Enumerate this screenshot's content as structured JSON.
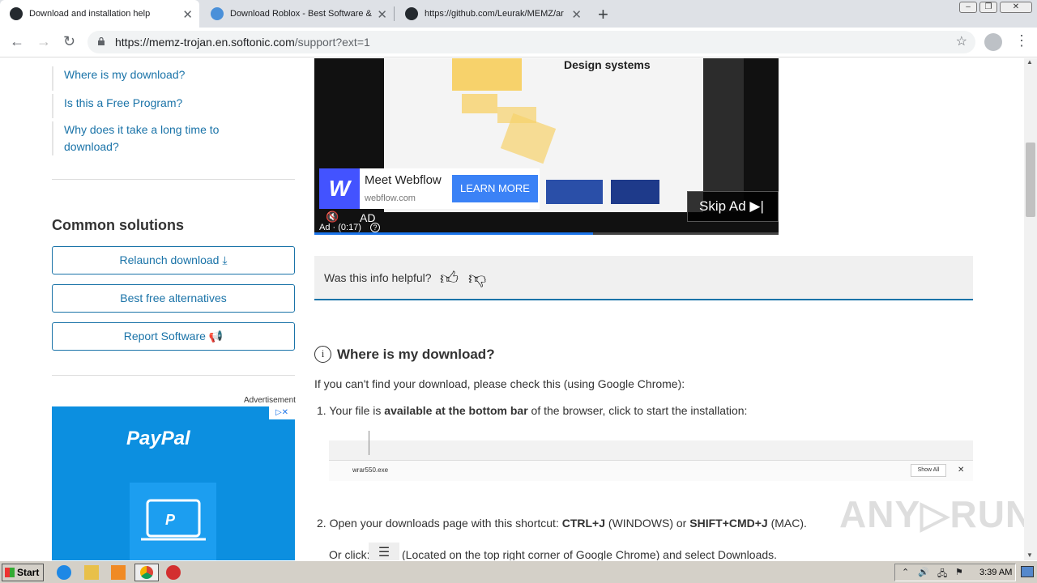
{
  "browser": {
    "tabs": [
      {
        "title": "Download and installation help",
        "active": true,
        "favicon_color": "#24292e"
      },
      {
        "title": "Download Roblox - Best Software &",
        "active": false,
        "favicon_color": "#4a90d9"
      },
      {
        "title": "https://github.com/Leurak/MEMZ/ar",
        "active": false,
        "favicon_color": "#24292e"
      }
    ],
    "new_tab": "+",
    "address": {
      "host": "https://memz-trojan.en.softonic.com",
      "path": "/support?ext=1"
    }
  },
  "sidebar": {
    "links": [
      "Where is my download?",
      "Is this a Free Program?",
      "Why does it take a long time to",
      "download?"
    ],
    "common_title": "Common solutions",
    "buttons": [
      "Relaunch download",
      "Best free alternatives",
      "Report Software"
    ],
    "advertisement_label": "Advertisement",
    "paypal_logo": "PayPal"
  },
  "video_ad": {
    "screen_title": "Design systems",
    "advertiser": "Meet Webflow",
    "advertiser_url": "webflow.com",
    "cta": "LEARN MORE",
    "skip": "Skip Ad",
    "ad_label": "AD",
    "ad_time": "Ad · (0:17)",
    "progress": 0.6
  },
  "helpful": {
    "question": "Was this info helpful?"
  },
  "article": {
    "heading": "Where is my download?",
    "intro": "If you can't find your download, please check this (using Google Chrome):",
    "step1_pre": "1. Your file is ",
    "step1_bold": "available at the bottom bar",
    "step1_post": " of the browser, click to start the installation:",
    "image_file": "wrar550.exe",
    "image_show_all": "Show All",
    "step2_pre": "2. Open your downloads page with this shortcut: ",
    "step2_k1": "CTRL+J",
    "step2_mid": " (WINDOWS) or ",
    "step2_k2": "SHIFT+CMD+J",
    "step2_post": " (MAC).",
    "step2b_pre": "Or click:",
    "step2b_post": "(Located on the top right corner of Google Chrome) and select Downloads."
  },
  "watermark": "ANY▷RUN",
  "taskbar": {
    "start": "Start",
    "clock": "3:39 AM"
  }
}
